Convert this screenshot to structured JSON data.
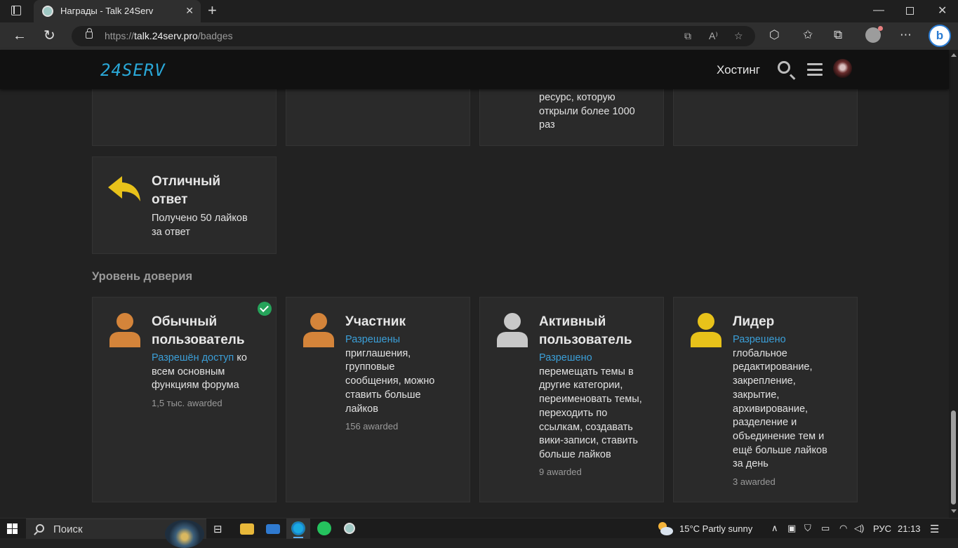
{
  "browser": {
    "tab_title": "Награды - Talk 24Serv",
    "url_scheme": "https://",
    "url_host": "talk.24serv.pro",
    "url_path": "/badges"
  },
  "site": {
    "logo": "24SERV",
    "nav_hosting": "Хостинг"
  },
  "top_partial_cards": [
    {
      "text": ""
    },
    {
      "text": ""
    },
    {
      "text_lines": [
        "ресурс, которую",
        "открыли более 1000",
        "раз"
      ]
    },
    {
      "text": ""
    }
  ],
  "great_reply": {
    "title_line1": "Отличный",
    "title_line2": "ответ",
    "desc_line1": "Получено 50 лайков",
    "desc_line2": "за ответ",
    "icon": "reply-icon",
    "color": "#e8c21a"
  },
  "trust_section": {
    "title": "Уровень доверия",
    "cards": [
      {
        "title_lines": [
          "Обычный",
          "пользователь"
        ],
        "link": "Разрешён доступ",
        "desc_after_link": " ко",
        "desc_lines": [
          "всем основным",
          "функциям форума"
        ],
        "awarded": "1,5 тыс. awarded",
        "icon": "user-icon",
        "color": "#d4843a",
        "granted": true
      },
      {
        "title_lines": [
          "Участник"
        ],
        "link": "Разрешены",
        "desc_lines": [
          "приглашения,",
          "групповые",
          "сообщения, можно",
          "ставить больше",
          "лайков"
        ],
        "awarded": "156 awarded",
        "icon": "user-icon",
        "color": "#d4843a"
      },
      {
        "title_lines": [
          "Активный",
          "пользователь"
        ],
        "link": "Разрешено",
        "desc_lines": [
          "перемещать темы в",
          "другие категории,",
          "переименовать темы,",
          "переходить по",
          "ссылкам, создавать",
          "вики-записи, ставить",
          "больше лайков"
        ],
        "awarded": "9 awarded",
        "icon": "user-icon",
        "color": "#c8c8c8"
      },
      {
        "title_lines": [
          "Лидер"
        ],
        "link": "Разрешено",
        "desc_lines": [
          "глобальное",
          "редактирование,",
          "закрепление,",
          "закрытие,",
          "архивирование,",
          "разделение и",
          "объединение тем и",
          "ещё больше лайков",
          "за день"
        ],
        "awarded": "3 awarded",
        "icon": "user-icon",
        "color": "#e8c21a"
      }
    ]
  },
  "taskbar": {
    "search_placeholder": "Поиск",
    "weather": "15°C  Partly sunny",
    "lang": "РУС",
    "time": "21:13"
  }
}
